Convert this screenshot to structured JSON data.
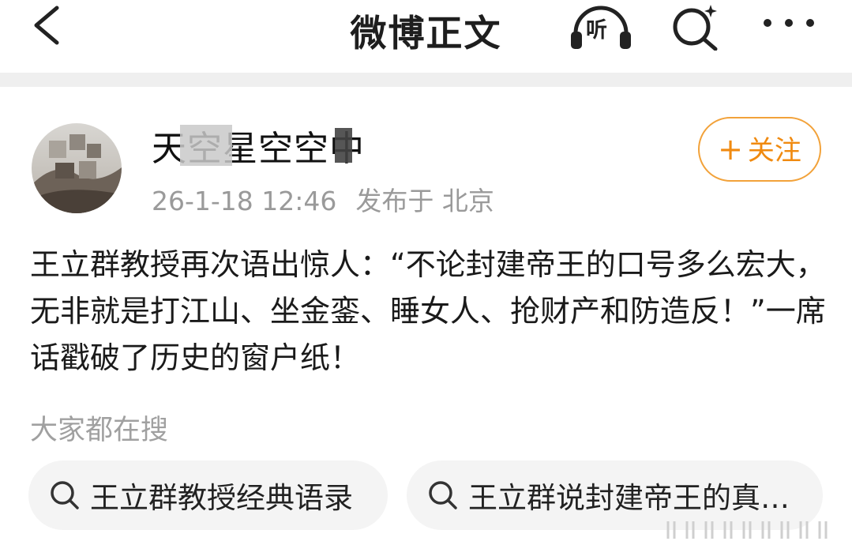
{
  "header": {
    "title": "微博正文",
    "listen_label": "听"
  },
  "post": {
    "username": "天空星空空中",
    "timestamp": "26-1-18 12:46",
    "location": "发布于 北京",
    "follow_label": "关注",
    "follow_plus": "+",
    "content": "王立群教授再次语出惊人：“不论封建帝王的口号多么宏大，无非就是打江山、坐金銮、睡女人、抢财产和防造反！”一席话戳破了历史的窗户纸！"
  },
  "search_section": {
    "title": "大家都在搜",
    "chips": [
      {
        "label": "王立群教授经典语录"
      },
      {
        "label": "王立群说封建帝王的真…"
      }
    ]
  },
  "colors": {
    "accent": "#f08a10",
    "follow_border": "#f2a23a",
    "meta_text": "#9a9a9a",
    "chip_bg": "#f4f4f4"
  },
  "icons": [
    "chevron-left-icon",
    "headphones-icon",
    "search-sparkle-icon",
    "more-dots-icon",
    "search-icon"
  ]
}
